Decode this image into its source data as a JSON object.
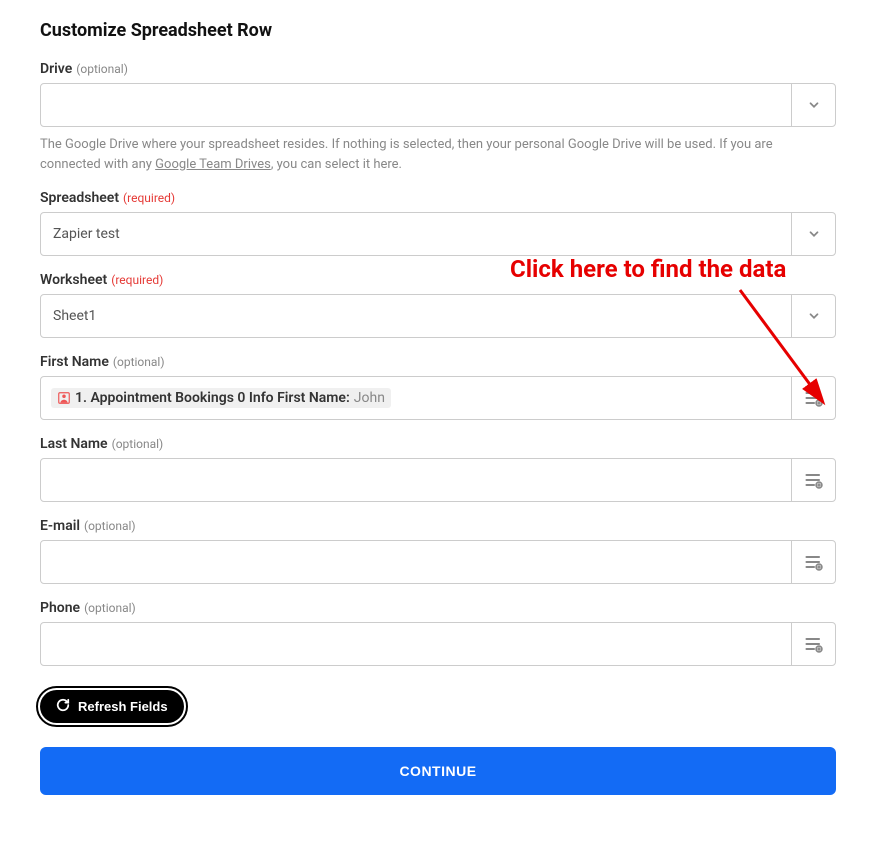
{
  "title": "Customize Spreadsheet Row",
  "fields": {
    "drive": {
      "label": "Drive",
      "hint": "(optional)",
      "value": "",
      "help_pre": "The Google Drive where your spreadsheet resides. If nothing is selected, then your personal Google Drive will be used. If you are connected with any ",
      "help_link": "Google Team Drives",
      "help_post": ", you can select it here."
    },
    "spreadsheet": {
      "label": "Spreadsheet",
      "hint": "(required)",
      "value": "Zapier test"
    },
    "worksheet": {
      "label": "Worksheet",
      "hint": "(required)",
      "value": "Sheet1"
    },
    "first_name": {
      "label": "First Name",
      "hint": "(optional)",
      "token_label": "1. Appointment Bookings 0 Info First Name:",
      "token_value": "John"
    },
    "last_name": {
      "label": "Last Name",
      "hint": "(optional)"
    },
    "email": {
      "label": "E-mail",
      "hint": "(optional)"
    },
    "phone": {
      "label": "Phone",
      "hint": "(optional)"
    }
  },
  "buttons": {
    "refresh": "Refresh Fields",
    "continue": "CONTINUE"
  },
  "annotation": "Click here to find the data"
}
